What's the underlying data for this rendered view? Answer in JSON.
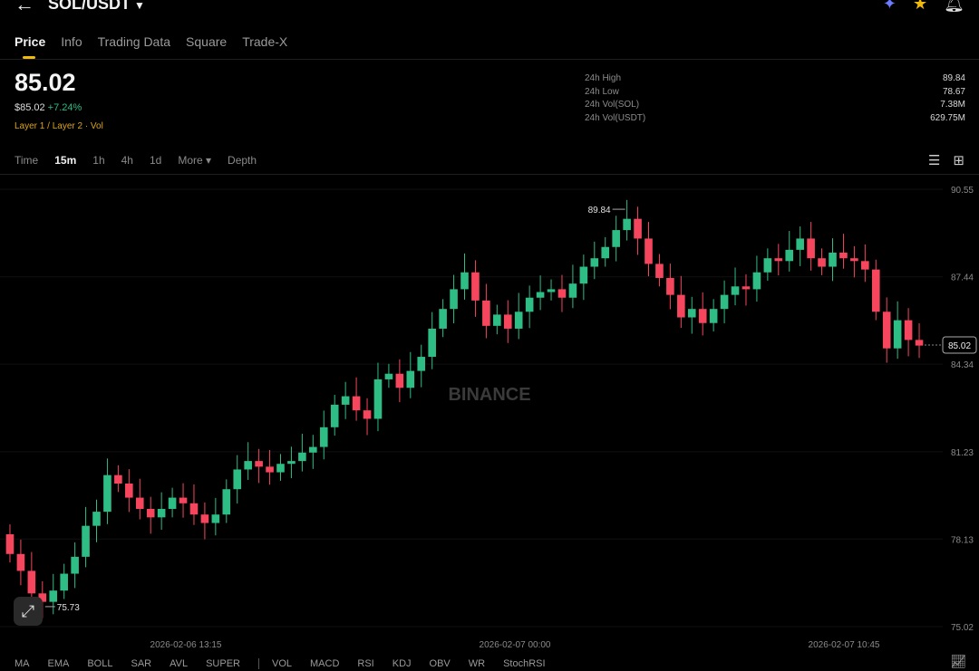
{
  "header": {
    "pair": "SOL/USDT",
    "tabs": [
      "Price",
      "Info",
      "Trading Data",
      "Square",
      "Trade-X"
    ],
    "active_tab": "Price"
  },
  "ticker": {
    "last_price": "85.02",
    "price_fiat": "$85.02",
    "change": "+7.24%",
    "tags": "Layer 1 / Layer 2 · Vol",
    "stats": [
      {
        "label": "24h High",
        "value": "89.84"
      },
      {
        "label": "24h Low",
        "value": "78.67"
      },
      {
        "label": "24h Vol(SOL)",
        "value": "7.38M"
      },
      {
        "label": "24h Vol(USDT)",
        "value": "629.75M"
      }
    ]
  },
  "intervals": [
    "Time",
    "15m",
    "1h",
    "4h",
    "1d",
    "More ▾",
    "Depth"
  ],
  "active_interval": "15m",
  "indicators": [
    "MA",
    "EMA",
    "BOLL",
    "SAR",
    "AVL",
    "SUPER",
    "VOL",
    "MACD",
    "RSI",
    "KDJ",
    "OBV",
    "WR",
    "StochRSI"
  ],
  "colors": {
    "up": "#2ebd85",
    "down": "#f6465d",
    "accent": "#f0b90b",
    "bg": "#000000"
  },
  "icons": [
    "back-arrow-icon",
    "caret-down-icon",
    "ai-sparkle-icon",
    "star-icon",
    "bell-icon",
    "settings-icon",
    "grid-icon",
    "expand-icon",
    "chart-type-icon"
  ],
  "chart_data": {
    "type": "candlestick",
    "watermark": "BINANCE",
    "y_ticks": [
      90.55,
      87.44,
      84.34,
      81.23,
      78.13,
      75.02
    ],
    "ylim": [
      75.02,
      90.55
    ],
    "x_ticks": [
      "2026-02-06 13:15",
      "2026-02-07 00:00",
      "2026-02-07 10:45"
    ],
    "high_label": "89.84",
    "low_label": "75.73",
    "current_price_label": "85.02",
    "closes": [
      77.6,
      77.0,
      76.2,
      75.9,
      76.3,
      76.9,
      77.5,
      78.6,
      79.1,
      80.4,
      80.1,
      79.6,
      79.2,
      78.9,
      79.2,
      79.6,
      79.4,
      79.0,
      78.7,
      79.0,
      79.9,
      80.6,
      80.9,
      80.7,
      80.5,
      80.8,
      80.9,
      81.2,
      81.4,
      82.1,
      82.9,
      83.2,
      82.7,
      82.4,
      83.8,
      84.0,
      83.5,
      84.1,
      84.6,
      85.6,
      86.3,
      87.0,
      87.6,
      86.6,
      85.7,
      86.1,
      85.6,
      86.2,
      86.7,
      86.9,
      87.0,
      86.7,
      87.2,
      87.8,
      88.1,
      88.5,
      89.1,
      89.5,
      88.8,
      87.9,
      87.4,
      86.8,
      86.0,
      86.3,
      85.8,
      86.3,
      86.8,
      87.1,
      87.0,
      87.6,
      88.1,
      88.0,
      88.4,
      88.8,
      88.1,
      87.8,
      88.3,
      88.1,
      88.0,
      87.7,
      86.2,
      84.9,
      85.9,
      85.2,
      85.0
    ],
    "series": [
      {
        "name": "open",
        "values": [
          78.3,
          77.6,
          77.0,
          76.2,
          75.9,
          76.3,
          76.9,
          77.5,
          78.6,
          79.1,
          80.4,
          80.1,
          79.6,
          79.2,
          78.9,
          79.2,
          79.6,
          79.4,
          79.0,
          78.7,
          79.0,
          79.9,
          80.6,
          80.9,
          80.7,
          80.5,
          80.8,
          80.9,
          81.2,
          81.4,
          82.1,
          82.9,
          83.2,
          82.7,
          82.4,
          83.8,
          84.0,
          83.5,
          84.1,
          84.6,
          85.6,
          86.3,
          87.0,
          87.6,
          86.6,
          85.7,
          86.1,
          85.6,
          86.2,
          86.7,
          86.9,
          87.0,
          86.7,
          87.2,
          87.8,
          88.1,
          88.5,
          89.1,
          89.5,
          88.8,
          87.9,
          87.4,
          86.8,
          86.0,
          86.3,
          85.8,
          86.3,
          86.8,
          87.1,
          87.0,
          87.6,
          88.1,
          88.0,
          88.4,
          88.8,
          88.1,
          87.8,
          88.3,
          88.1,
          88.0,
          87.7,
          86.2,
          84.9,
          85.9,
          85.2
        ]
      }
    ]
  }
}
